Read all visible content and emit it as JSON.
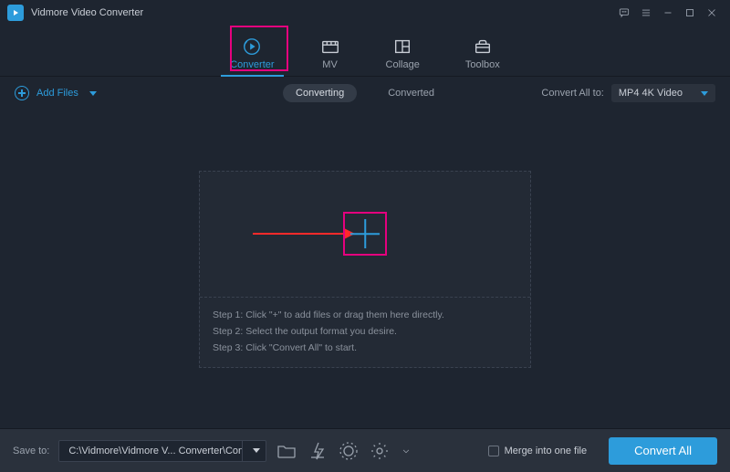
{
  "app": {
    "title": "Vidmore Video Converter"
  },
  "nav": {
    "items": [
      {
        "label": "Converter"
      },
      {
        "label": "MV"
      },
      {
        "label": "Collage"
      },
      {
        "label": "Toolbox"
      }
    ]
  },
  "toolbar": {
    "add_label": "Add Files",
    "seg_converting": "Converting",
    "seg_converted": "Converted",
    "convert_all_to_label": "Convert All to:",
    "format_selected": "MP4 4K Video"
  },
  "dropzone": {
    "step1": "Step 1: Click \"+\" to add files or drag them here directly.",
    "step2": "Step 2: Select the output format you desire.",
    "step3": "Step 3: Click \"Convert All\" to start."
  },
  "footer": {
    "save_to_label": "Save to:",
    "path": "C:\\Vidmore\\Vidmore V... Converter\\Converted",
    "merge_label": "Merge into one file",
    "convert_button": "Convert All"
  }
}
